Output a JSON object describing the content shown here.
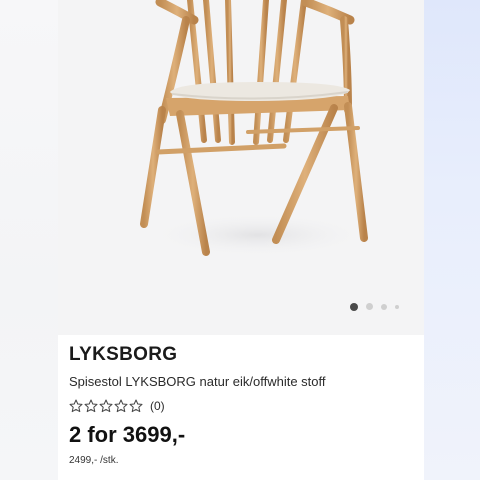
{
  "product": {
    "name": "LYKSBORG",
    "description": "Spisestol LYKSBORG natur eik/offwhite stoff",
    "rating_count": "(0)",
    "price": "2 for 3699,-",
    "unit_price": "2499,- /stk.",
    "image_icon": "chair-photo"
  },
  "rating": {
    "stars_total": 5,
    "stars_filled": 0
  },
  "carousel": {
    "total": 4,
    "active_index": 0
  },
  "colors": {
    "wood": "#d2a26c",
    "cushion": "#ece8e1",
    "active_dot": "#4a4a4a",
    "inactive_dot": "#cfcfcf"
  }
}
